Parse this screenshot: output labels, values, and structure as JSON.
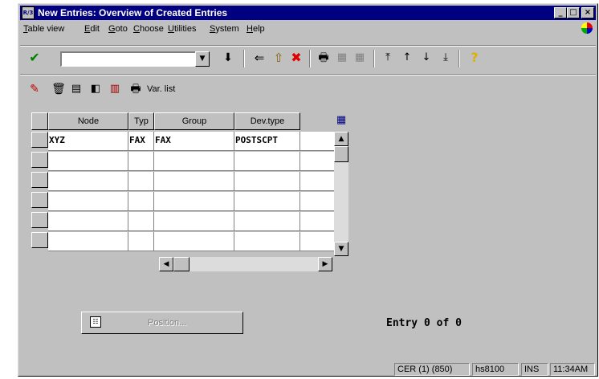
{
  "window": {
    "icon_text": "R/3",
    "title": "New Entries: Overview of Created Entries"
  },
  "menu": [
    {
      "label": "Table view",
      "u": "T",
      "rest": "able view"
    },
    {
      "label": "Edit",
      "u": "E",
      "rest": "dit"
    },
    {
      "label": "Goto",
      "u": "G",
      "rest": "oto"
    },
    {
      "label": "Choose",
      "u": "C",
      "rest": "hoose"
    },
    {
      "label": "Utilities",
      "u": "U",
      "rest": "tilities"
    },
    {
      "label": "System",
      "u": "S",
      "rest": "ystem"
    },
    {
      "label": "Help",
      "u": "H",
      "rest": "elp"
    }
  ],
  "toolbar": {
    "command_field_value": "",
    "help_glyph": "?"
  },
  "app_toolbar": {
    "var_list_label": "Var. list"
  },
  "table": {
    "columns": [
      "Node",
      "Typ",
      "Group",
      "Dev.type"
    ],
    "rows": [
      [
        "XYZ",
        "FAX",
        "FAX",
        "POSTSCPT"
      ],
      [
        "",
        "",
        "",
        ""
      ],
      [
        "",
        "",
        "",
        ""
      ],
      [
        "",
        "",
        "",
        ""
      ],
      [
        "",
        "",
        "",
        ""
      ],
      [
        "",
        "",
        "",
        ""
      ]
    ]
  },
  "position_button": {
    "label": "Position..."
  },
  "entry_info": "Entry 0 of 0",
  "status": {
    "system": "CER (1) (850)",
    "server": "hs8100",
    "mode": "INS",
    "time": "11:34AM"
  },
  "colors": {
    "title_bar": "#000080",
    "window_bg": "#c0c0c0",
    "check_green": "#008000",
    "cancel_red": "#e00000",
    "help_yellow": "#ffd800"
  }
}
